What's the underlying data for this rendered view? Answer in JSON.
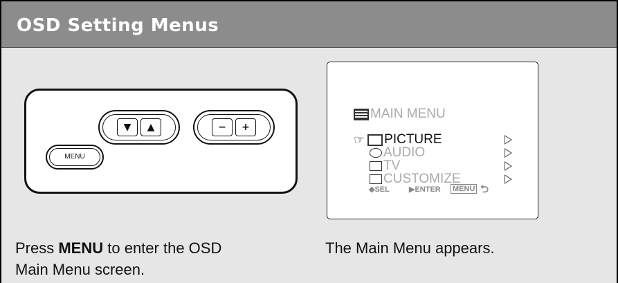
{
  "header": {
    "title": "OSD Setting Menus"
  },
  "remote": {
    "down_glyph": "▼",
    "up_glyph": "▲",
    "minus_glyph": "−",
    "plus_glyph": "+",
    "menu_label": "MENU"
  },
  "osd": {
    "title": "MAIN  MENU",
    "items": [
      {
        "label": "PICTURE",
        "icon": "picture-icon",
        "selected": true
      },
      {
        "label": "AUDIO",
        "icon": "audio-icon",
        "selected": false
      },
      {
        "label": "TV",
        "icon": "tv-icon",
        "selected": false
      },
      {
        "label": "CUSTOMIZE",
        "icon": "customize-icon",
        "selected": false
      }
    ],
    "pointer_glyph": "☞",
    "footer": {
      "sel": "◆SEL",
      "enter": "▶ENTER",
      "menu": "MENU",
      "back_glyph": "⮌"
    }
  },
  "captions": {
    "left_prefix": "Press ",
    "left_bold": "MENU",
    "left_suffix": " to enter the OSD",
    "left_line2": "Main Menu screen.",
    "right": "The Main Menu appears."
  }
}
